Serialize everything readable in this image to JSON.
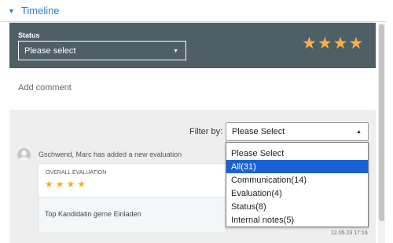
{
  "section": {
    "title": "Timeline"
  },
  "status": {
    "label": "Status",
    "value": "Please select",
    "rating": 4
  },
  "comment": {
    "placeholder": "Add comment"
  },
  "filter": {
    "label": "Filter by:",
    "value": "Please Select",
    "options": [
      "Please Select",
      "All(31)",
      "Communication(14)",
      "Evaluation(4)",
      "Status(8)",
      "Internal notes(5)"
    ],
    "highlighted_index": 1
  },
  "entry": {
    "text": "Gschwend, Marc has added a new evaluation",
    "overall_label": "OVERALL EVALUATION",
    "rating": 4,
    "note": "Top Kandidatin gerne Einladen",
    "timestamp": "12.05.23 17:16"
  },
  "colors": {
    "accent": "#2f7fc1",
    "panel": "#4f5f66",
    "star": "#f6b04a",
    "highlight": "#1a61d6"
  },
  "icons": {
    "header_caret": "caret-down-icon",
    "star": "star-icon",
    "avatar": "user-avatar-icon"
  }
}
